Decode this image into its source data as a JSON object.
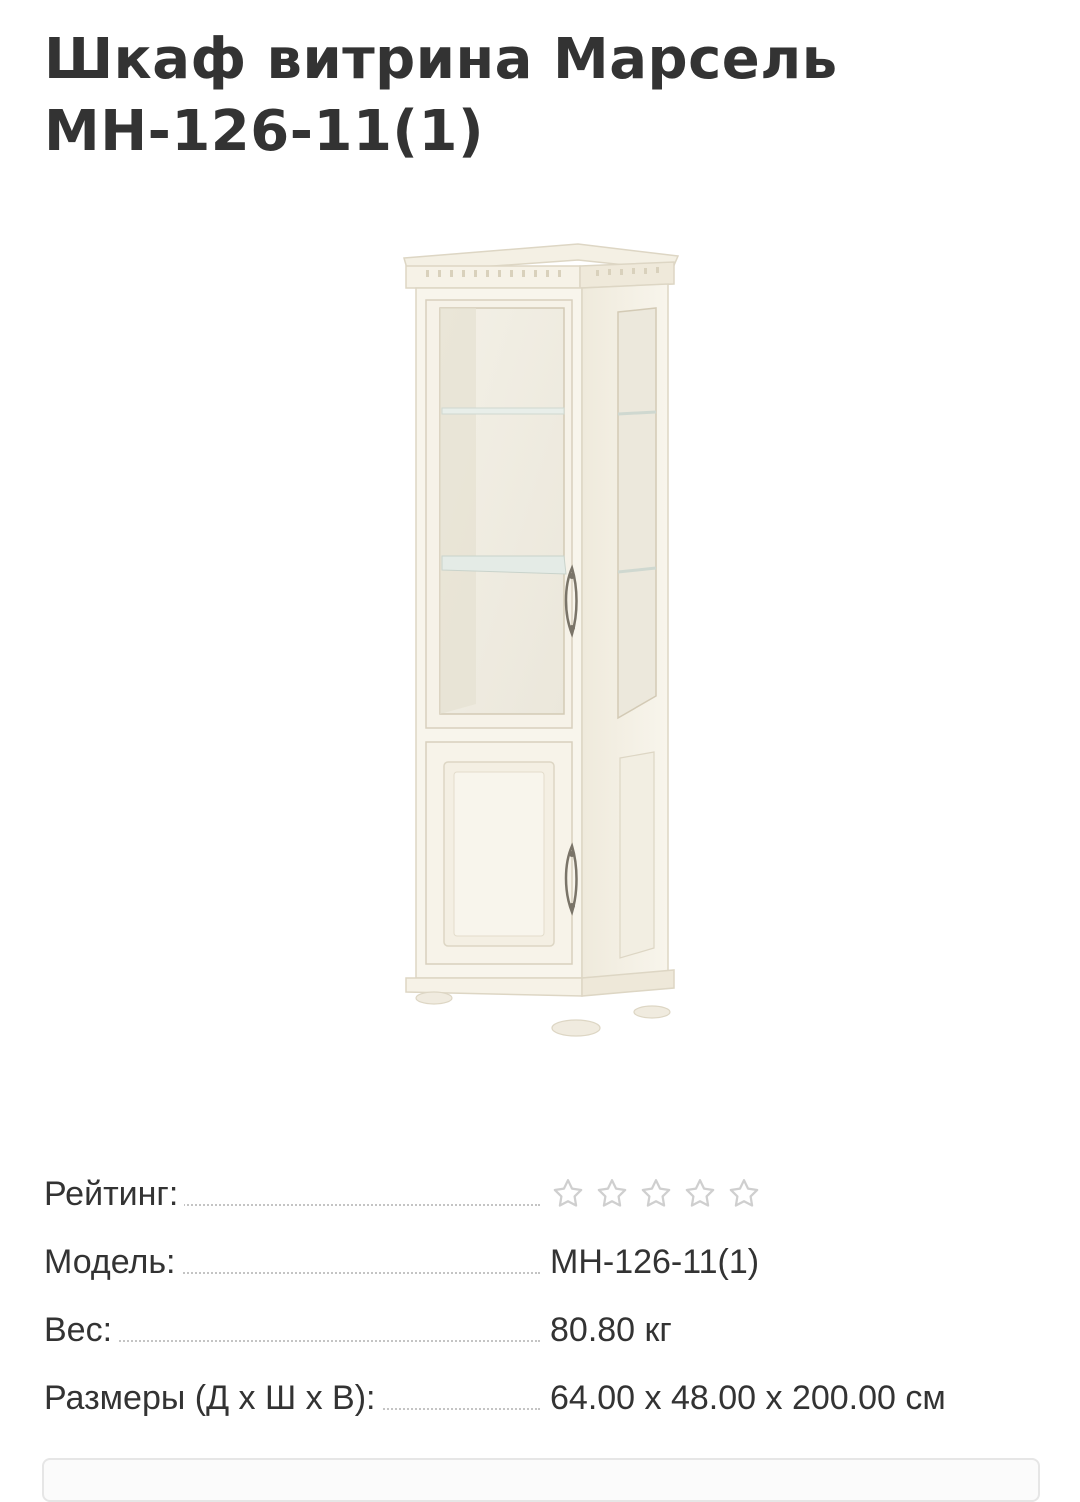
{
  "product": {
    "title": "Шкаф витрина Марсель МН-126-11(1)",
    "image_icon": "cabinet-display-image"
  },
  "specs": {
    "rating": {
      "label": "Рейтинг:",
      "value": 0,
      "max": 5,
      "icon": "star-outline-icon"
    },
    "model": {
      "label": "Модель:",
      "value": "МН-126-11(1)"
    },
    "weight": {
      "label": "Вес:",
      "value": "80.80 кг"
    },
    "dimensions": {
      "label": "Размеры (Д х Ш х В):",
      "value": "64.00 x 48.00 x 200.00 см"
    }
  },
  "colors": {
    "text": "#333333",
    "dots": "#c4c4c4",
    "star_outline": "#cfcfcf",
    "cabinet_body": "#f7f3e8"
  }
}
